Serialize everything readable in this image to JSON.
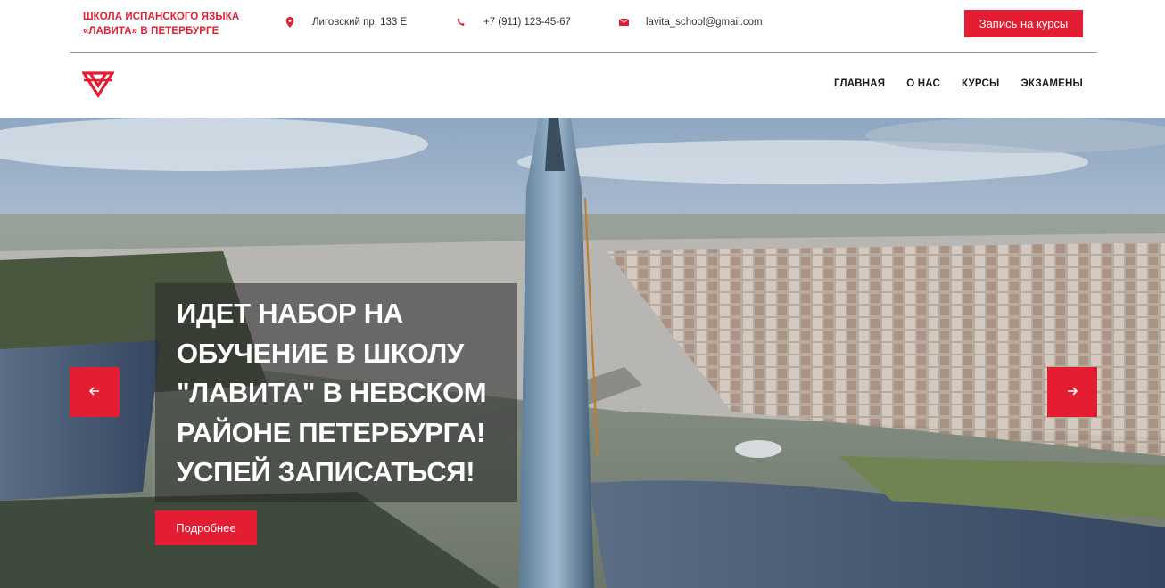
{
  "header": {
    "school_name_line1": "ШКОЛА ИСПАНСКОГО ЯЗЫКА",
    "school_name_line2": "«ЛАВИТА» В ПЕТЕРБУРГЕ",
    "address": "Лиговский пр. 133 Е",
    "phone": "+7 (911) 123-45-67",
    "email": "lavita_school@gmail.com",
    "signup_label": "Запись на курсы",
    "icons": {
      "address": "map-pin-icon",
      "phone": "phone-icon",
      "email": "envelope-icon"
    }
  },
  "nav": {
    "items": [
      {
        "label": "ГЛАВНАЯ"
      },
      {
        "label": "О НАС"
      },
      {
        "label": "КУРСЫ"
      },
      {
        "label": "ЭКЗАМЕНЫ"
      }
    ]
  },
  "hero": {
    "headline_lines": [
      "ИДЕТ НАБОР НА",
      "ОБУЧЕНИЕ В ШКОЛУ",
      "\"ЛАВИТА\" В НЕВСКОМ",
      "РАЙОНЕ ПЕТЕРБУРГА!",
      "УСПЕЙ ЗАПИСАТЬСЯ!"
    ],
    "more_label": "Подробнее",
    "prev_icon": "arrow-left-icon",
    "next_icon": "arrow-right-icon"
  },
  "colors": {
    "accent": "#e31e32",
    "text_dark": "#1a1a1a",
    "text_muted": "#333333"
  }
}
